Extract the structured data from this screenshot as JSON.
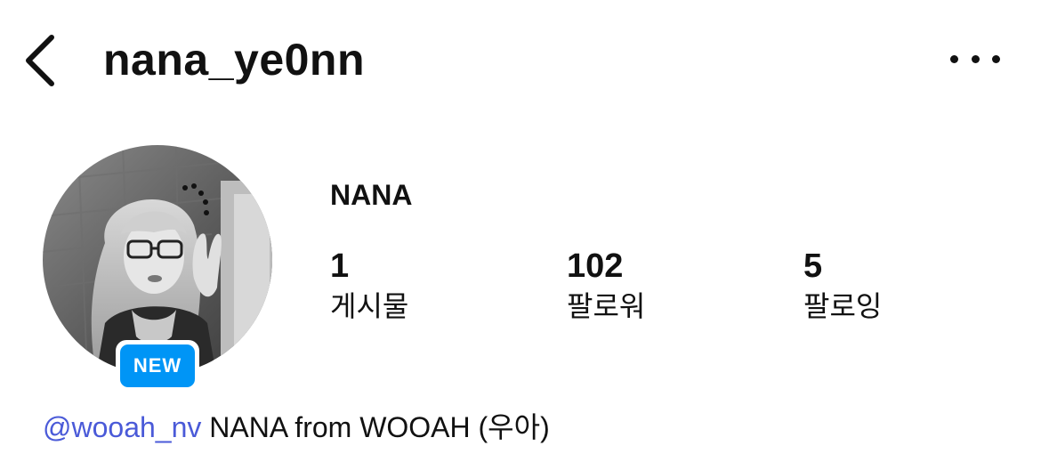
{
  "header": {
    "back_icon": "chevron-left-icon",
    "username": "nana_ye0nn",
    "more_icon": "more-horizontal-icon"
  },
  "profile": {
    "avatar_alt": "profile photo",
    "badge": "NEW",
    "badge_color": "#0095f6",
    "display_name": "NANA"
  },
  "stats": [
    {
      "value": "1",
      "label": "게시물"
    },
    {
      "value": "102",
      "label": "팔로워"
    },
    {
      "value": "5",
      "label": "팔로잉"
    }
  ],
  "bio": {
    "mention": "@wooah_nv",
    "text": " NANA from WOOAH (",
    "text_ko": "우아",
    "text_end": ")",
    "mention_color": "#4a5ad8"
  }
}
